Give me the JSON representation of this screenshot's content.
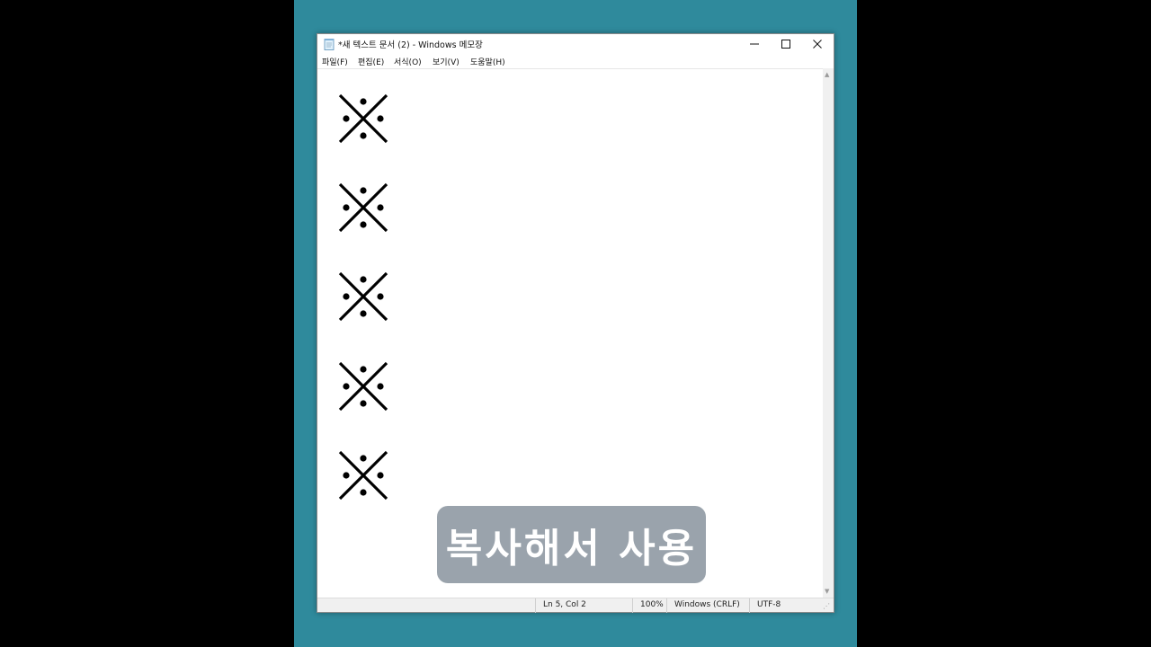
{
  "window": {
    "title": "*새 텍스트 문서 (2) - Windows 메모장",
    "controls": {
      "minimize": "—",
      "maximize": "☐",
      "close": "✕"
    }
  },
  "menu": [
    {
      "label": "파일(F)"
    },
    {
      "label": "편집(E)"
    },
    {
      "label": "서식(O)"
    },
    {
      "label": "보기(V)"
    },
    {
      "label": "도움말(H)"
    }
  ],
  "editor": {
    "lines": [
      "※",
      "※",
      "※",
      "※",
      "※"
    ]
  },
  "status": {
    "position": "Ln 5, Col 2",
    "zoom": "100%",
    "line_ending": "Windows (CRLF)",
    "encoding": "UTF-8"
  },
  "overlay": {
    "caption": "복사해서 사용"
  },
  "colors": {
    "background_frame": "#2f8a9c",
    "caption_bg": "#919ba5"
  },
  "icons": {
    "app": "notepad-icon",
    "scroll_up": "scroll-up-arrow-icon",
    "scroll_down": "scroll-down-arrow-icon",
    "grip": "resize-grip-icon"
  }
}
